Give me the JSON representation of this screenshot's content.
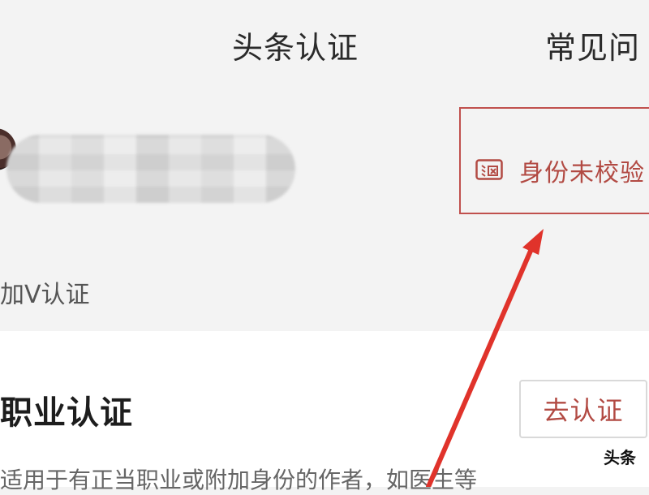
{
  "header": {
    "tab_title": "头条认证",
    "tab_faq": "常见问"
  },
  "profile": {
    "id_status_label": "身份未校验",
    "v_cert_hint": "加V认证"
  },
  "card": {
    "title": "职业认证",
    "go_button": "去认证",
    "description": "适用于有正当职业或附加身份的作者，如医生等"
  },
  "watermark": "头条",
  "colors": {
    "accent": "#b24a43",
    "annotation_arrow": "#e0332b",
    "highlight_box": "#c0504d"
  },
  "icons": {
    "id_status": "id-card-icon",
    "annotation": "red-arrow-annotation"
  }
}
